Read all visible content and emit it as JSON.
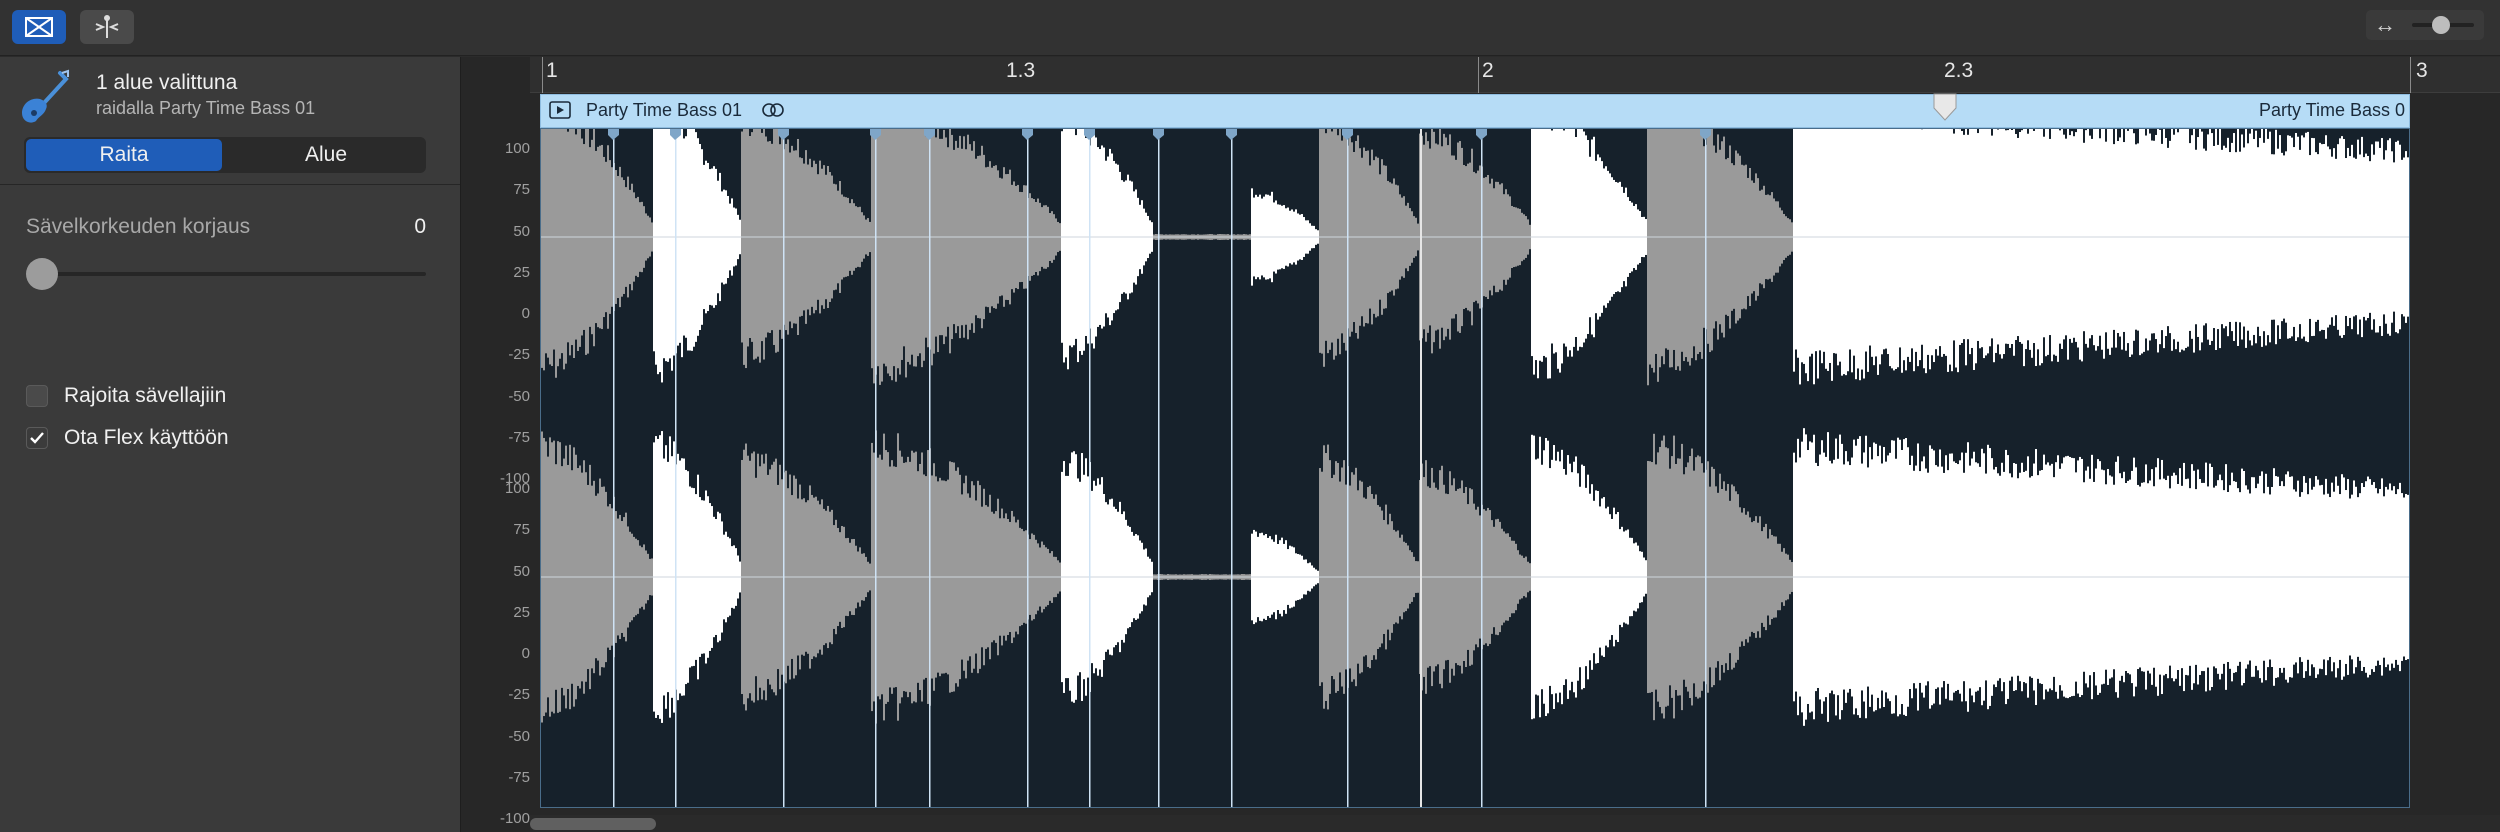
{
  "toolbar": {
    "flex_button_icon": "flex-icon",
    "tool_button_icon": "flex-tool-icon",
    "zoom_icon": "horizontal-zoom-icon"
  },
  "inspector": {
    "selection_title": "1 alue valittuna",
    "selection_subtitle": "raidalla Party Time Bass 01",
    "tabs": [
      {
        "label": "Raita",
        "active": true
      },
      {
        "label": "Alue",
        "active": false
      }
    ],
    "pitch_correction": {
      "label": "Sävelkorkeuden korjaus",
      "value": "0"
    },
    "checkboxes": [
      {
        "label": "Rajoita sävellajiin",
        "checked": false
      },
      {
        "label": "Ota Flex käyttöön",
        "checked": true
      }
    ]
  },
  "ruler": {
    "markers": [
      "1",
      "1.3",
      "2",
      "2.3",
      "3"
    ]
  },
  "region": {
    "name": "Party Time Bass 01",
    "name_right": "Party Time Bass 0",
    "accent": "#b6dcf6"
  },
  "scale": {
    "channel_ticks": [
      "100",
      "75",
      "50",
      "25",
      "0",
      "-25",
      "-50",
      "-75",
      "-100"
    ]
  },
  "colors": {
    "accent": "#1f5db8",
    "waveform_bg": "#16212b",
    "waveform_white": "#ffffff",
    "waveform_grey": "#9a9a9a"
  }
}
